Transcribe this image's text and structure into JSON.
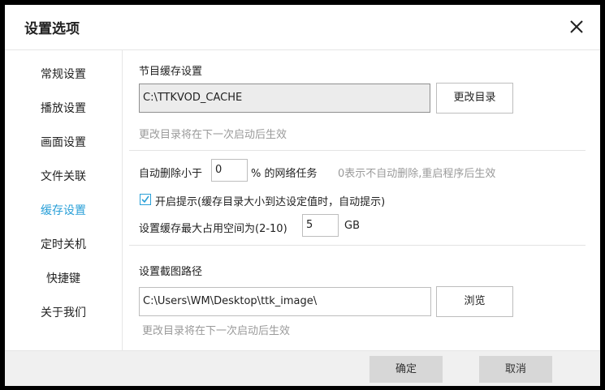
{
  "dialog": {
    "title": "设置选项",
    "close_icon": "close-icon"
  },
  "sidebar": {
    "items": [
      {
        "label": "常规设置",
        "active": false
      },
      {
        "label": "播放设置",
        "active": false
      },
      {
        "label": "画面设置",
        "active": false
      },
      {
        "label": "文件关联",
        "active": false
      },
      {
        "label": "缓存设置",
        "active": true
      },
      {
        "label": "定时关机",
        "active": false
      },
      {
        "label": "快捷键",
        "active": false
      },
      {
        "label": "关于我们",
        "active": false
      }
    ],
    "active_color": "#2aa0d8"
  },
  "cache": {
    "section_title": "节目缓存设置",
    "directory_value": "C:\\TTKVOD_CACHE",
    "change_dir_button": "更改目录",
    "change_hint": "更改目录将在下一次启动后生效",
    "auto_delete_label_pre": "自动删除小于",
    "auto_delete_value": "0",
    "auto_delete_label_post": "% 的网络任务",
    "auto_delete_hint": "0表示不自动删除,重启程序后生效",
    "prompt_checked": true,
    "prompt_label": "开启提示(缓存目录大小到达设定值时，自动提示)",
    "max_space_label": "设置缓存最大占用空间为(2-10)",
    "max_space_value": "5",
    "max_space_unit": "GB"
  },
  "screenshot": {
    "section_title": "设置截图路径",
    "path_value": "C:\\Users\\WM\\Desktop\\ttk_image\\",
    "browse_button": "浏览",
    "change_hint": "更改目录将在下一次启动后生效"
  },
  "footer": {
    "ok_button": "确定",
    "cancel_button": "取消"
  }
}
